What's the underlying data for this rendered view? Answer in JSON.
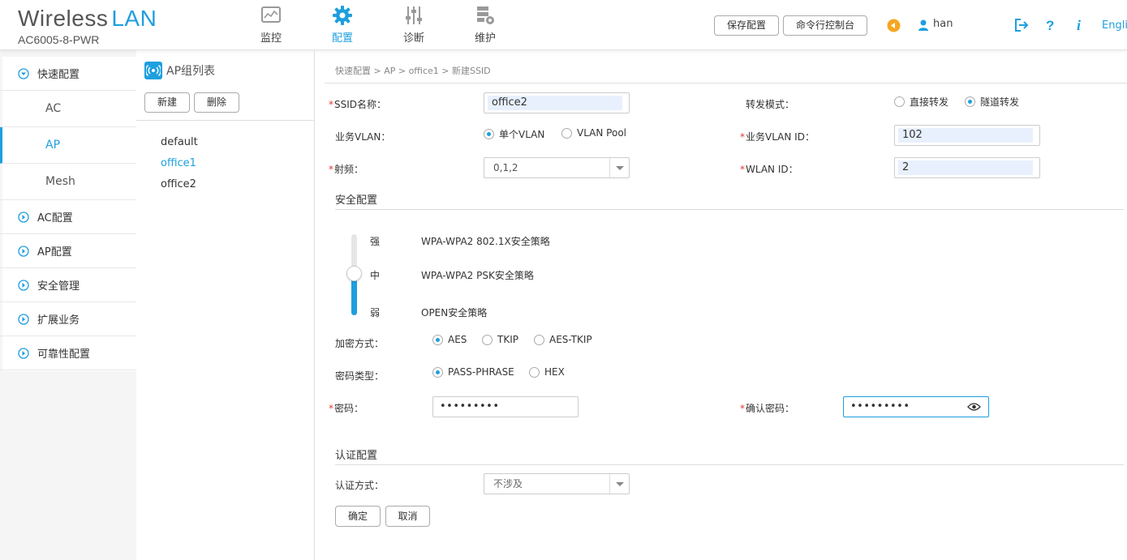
{
  "header": {
    "brand_main": "Wireless",
    "brand_accent": "LAN",
    "model": "AC6005-8-PWR",
    "nav": [
      {
        "label": "监控",
        "icon": "monitor-icon"
      },
      {
        "label": "配置",
        "icon": "gear-icon"
      },
      {
        "label": "诊断",
        "icon": "sliders-icon"
      },
      {
        "label": "维护",
        "icon": "maintenance-icon"
      }
    ],
    "save_config": "保存配置",
    "cli_console": "命令行控制台",
    "user": "han",
    "lang": "Engli",
    "accent_color": "#1e9fde"
  },
  "sidebar": {
    "quick_config": "快速配置",
    "sub_items": [
      "AC",
      "AP",
      "Mesh"
    ],
    "items": [
      "AC配置",
      "AP配置",
      "安全管理",
      "扩展业务",
      "可靠性配置"
    ]
  },
  "group": {
    "title": "AP组列表",
    "new_btn": "新建",
    "delete_btn": "删除",
    "list": [
      "default",
      "office1",
      "office2"
    ]
  },
  "breadcrumb": "快速配置 > AP > office1 > 新建SSID",
  "form": {
    "ssid_label": "SSID名称：",
    "ssid_value": "office2",
    "forward_label": "转发模式：",
    "forward_direct": "直接转发",
    "forward_tunnel": "隧道转发",
    "vlan_label": "业务VLAN：",
    "vlan_single": "单个VLAN",
    "vlan_pool": "VLAN Pool",
    "vlan_id_label": "业务VLAN ID：",
    "vlan_id_value": "102",
    "radio_label": "射频：",
    "radio_value": "0,1,2",
    "wlan_id_label": "WLAN ID：",
    "wlan_id_value": "2"
  },
  "security": {
    "title": "安全配置",
    "levels": [
      {
        "level": "强",
        "policy": "WPA-WPA2 802.1X安全策略"
      },
      {
        "level": "中",
        "policy": "WPA-WPA2 PSK安全策略"
      },
      {
        "level": "弱",
        "policy": "OPEN安全策略"
      }
    ],
    "encrypt_label": "加密方式：",
    "encrypt_options": [
      "AES",
      "TKIP",
      "AES-TKIP"
    ],
    "pwtype_label": "密码类型：",
    "pwtype_options": [
      "PASS-PHRASE",
      "HEX"
    ],
    "password_label": "密码：",
    "password_value": "•••••••••",
    "confirm_label": "确认密码：",
    "confirm_value": "•••••••••"
  },
  "auth": {
    "title": "认证配置",
    "method_label": "认证方式：",
    "method_value": "不涉及"
  },
  "actions": {
    "ok": "确定",
    "cancel": "取消"
  }
}
